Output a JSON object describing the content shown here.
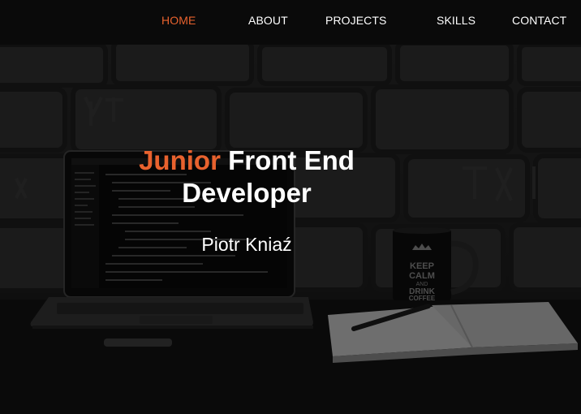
{
  "nav": {
    "items": [
      {
        "label": "HOME",
        "active": true
      },
      {
        "label": "ABOUT",
        "active": false
      },
      {
        "label": "PROJECTS",
        "active": false
      },
      {
        "label": "SKILLS",
        "active": false
      },
      {
        "label": "CONTACT",
        "active": false
      }
    ]
  },
  "hero": {
    "headline_accent": "Junior",
    "headline_rest_line1": "Front End",
    "headline_line2": "Developer",
    "name": "Piotr Kniaź"
  },
  "mug": {
    "line1": "KEEP",
    "line2": "CALM",
    "line3": "AND",
    "line4": "DRINK",
    "line5": "COFFEE"
  },
  "colors": {
    "accent": "#e8622e",
    "nav_background": "#0a0a0a",
    "text": "#ffffff"
  }
}
